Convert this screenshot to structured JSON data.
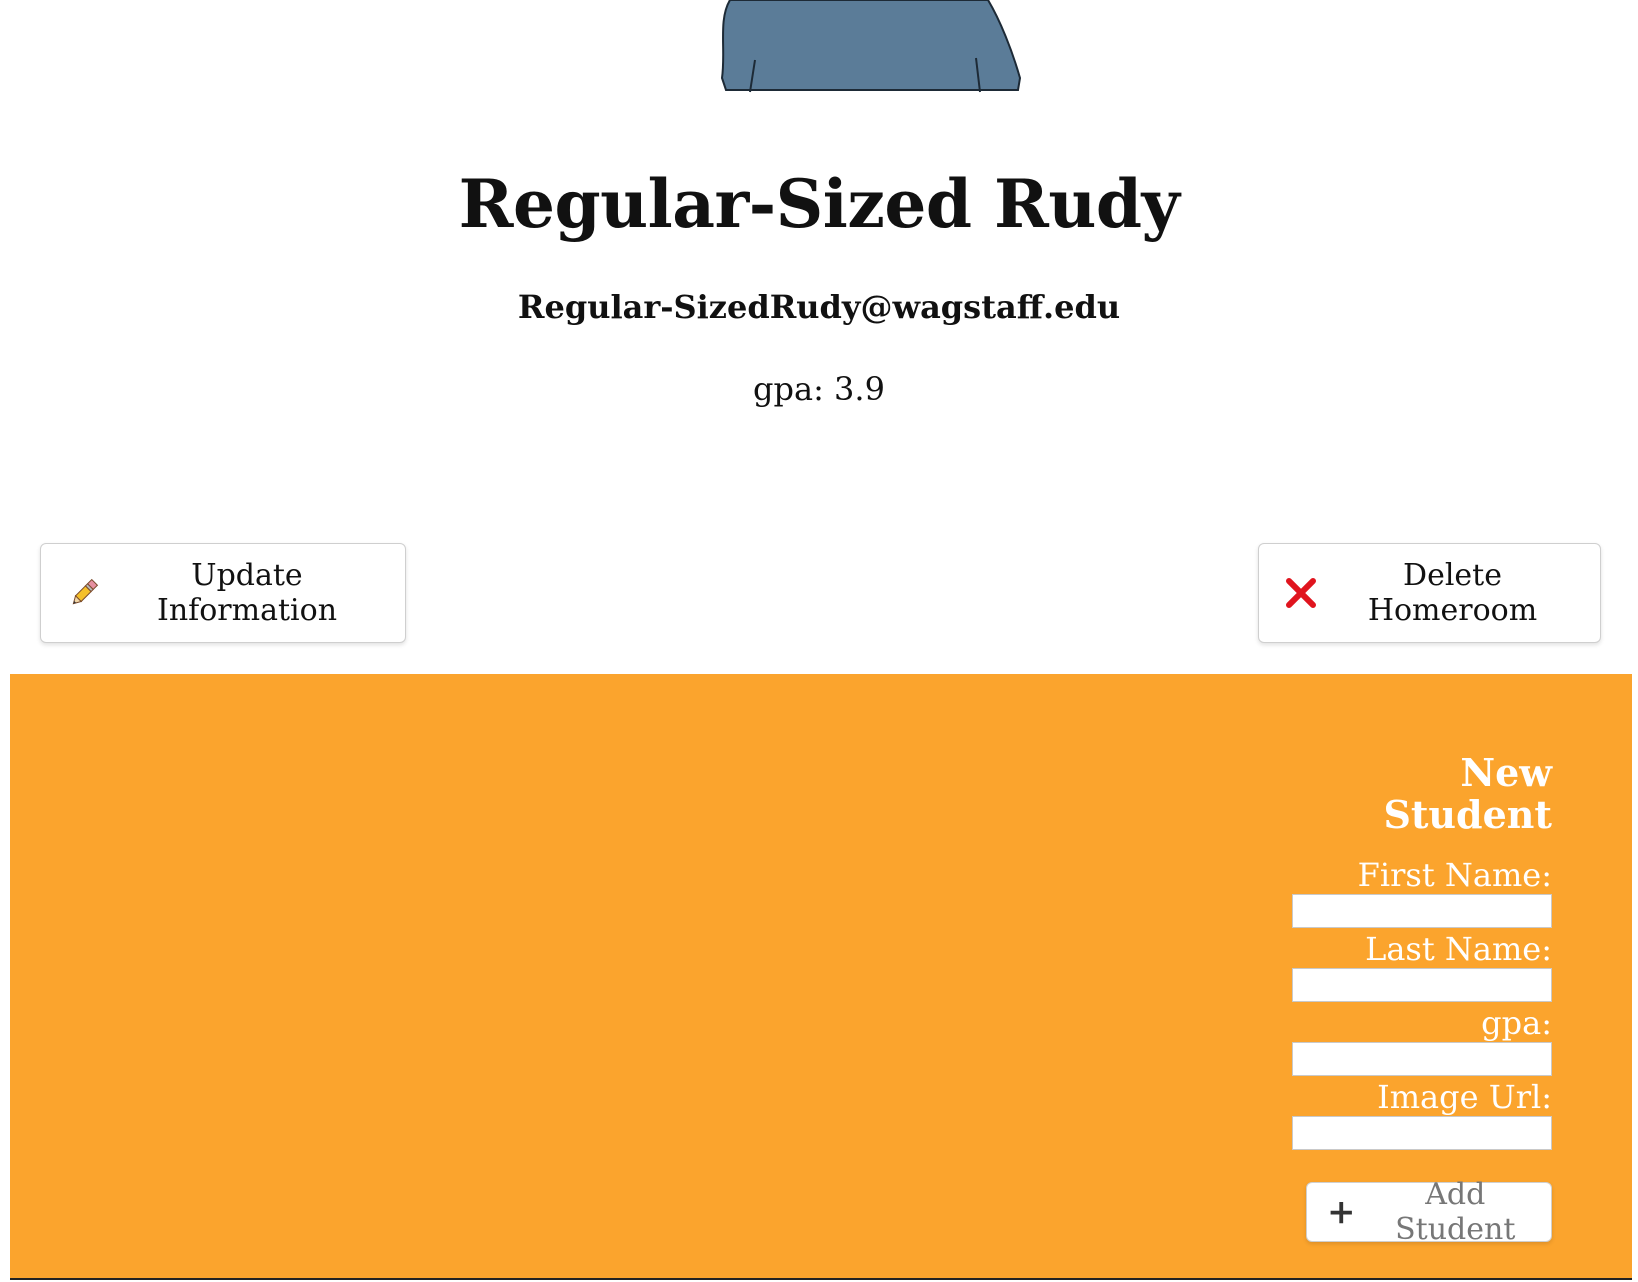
{
  "profile": {
    "name": "Regular-Sized Rudy",
    "email": "Regular-SizedRudy@wagstaff.edu",
    "gpa_label": "gpa:",
    "gpa_value": "3.9"
  },
  "actions": {
    "update_label": "Update Information",
    "update_icon": "pencil-icon",
    "delete_label": "Delete Homeroom",
    "delete_icon": "close-icon"
  },
  "new_student_form": {
    "title": "New Student",
    "fields": [
      {
        "label": "First Name:",
        "value": ""
      },
      {
        "label": "Last Name:",
        "value": ""
      },
      {
        "label": "gpa:",
        "value": ""
      },
      {
        "label": "Image Url:",
        "value": ""
      }
    ],
    "submit_label": "Add Student",
    "submit_icon": "plus-icon"
  },
  "colors": {
    "panel_background": "#fba42d",
    "avatar_shirt": "#5b7c98",
    "delete_icon": "#e0141e"
  }
}
